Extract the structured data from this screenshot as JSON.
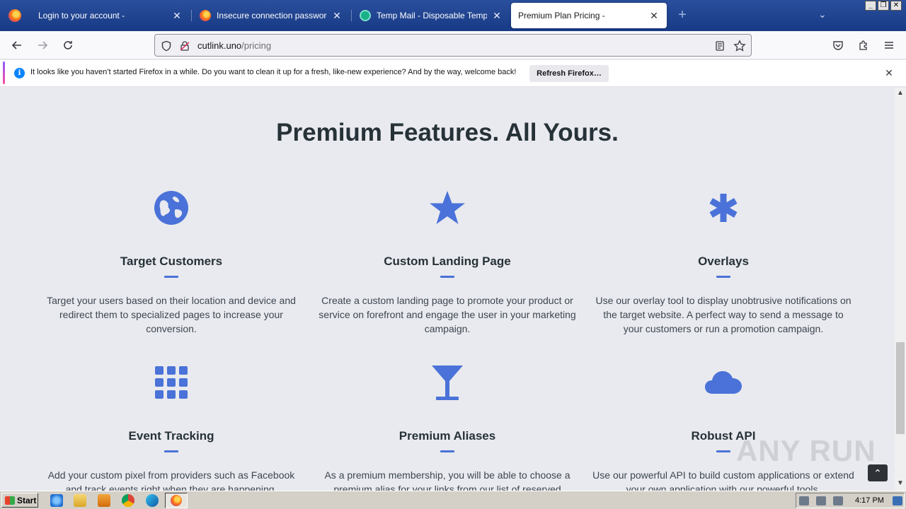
{
  "browser": {
    "tabs": [
      {
        "title": "Login to your account -",
        "favicon_color": "#1c3f8f",
        "active": false
      },
      {
        "title": "Insecure connection password war",
        "favicon_color": "#ff7a18",
        "active": false
      },
      {
        "title": "Temp Mail - Disposable Temporary E",
        "favicon_color": "#19b08a",
        "active": false
      },
      {
        "title": "Premium Plan Pricing -",
        "favicon_color": "#ffffff",
        "active": true
      }
    ],
    "new_tab_glyph": "+",
    "tab_list_glyph": "⌄",
    "window_controls": [
      "_",
      "❐",
      "✕"
    ],
    "url_host": "cutlink.uno",
    "url_path": "/pricing"
  },
  "notification": {
    "info_glyph": "i",
    "message": "It looks like you haven’t started Firefox in a while. Do you want to clean it up for a fresh, like-new experience? And by the way, welcome back!",
    "button_label": "Refresh Firefox…",
    "close_glyph": "✕"
  },
  "page": {
    "title": "Premium Features. All Yours.",
    "accent_color": "#4a72d8",
    "features": [
      {
        "icon": "globe-icon",
        "title": "Target Customers",
        "text": "Target your users based on their location and device and redirect them to specialized pages to increase your conversion."
      },
      {
        "icon": "star-icon",
        "title": "Custom Landing Page",
        "text": "Create a custom landing page to promote your product or service on forefront and engage the user in your marketing campaign."
      },
      {
        "icon": "asterisk-icon",
        "title": "Overlays",
        "text": "Use our overlay tool to display unobtrusive notifications on the target website. A perfect way to send a message to your customers or run a promotion campaign."
      },
      {
        "icon": "grid-icon",
        "title": "Event Tracking",
        "text": "Add your custom pixel from providers such as Facebook and track events right when they are happening."
      },
      {
        "icon": "glass-icon",
        "title": "Premium Aliases",
        "text": "As a premium membership, you will be able to choose a premium alias for your links from our list of reserved"
      },
      {
        "icon": "cloud-icon",
        "title": "Robust API",
        "text": "Use our powerful API to build custom applications or extend your own application with our powerful tools."
      }
    ],
    "back_to_top_glyph": "⌃"
  },
  "watermark": "ANY RUN",
  "taskbar": {
    "start_label": "Start",
    "clock": "4:17 PM"
  }
}
